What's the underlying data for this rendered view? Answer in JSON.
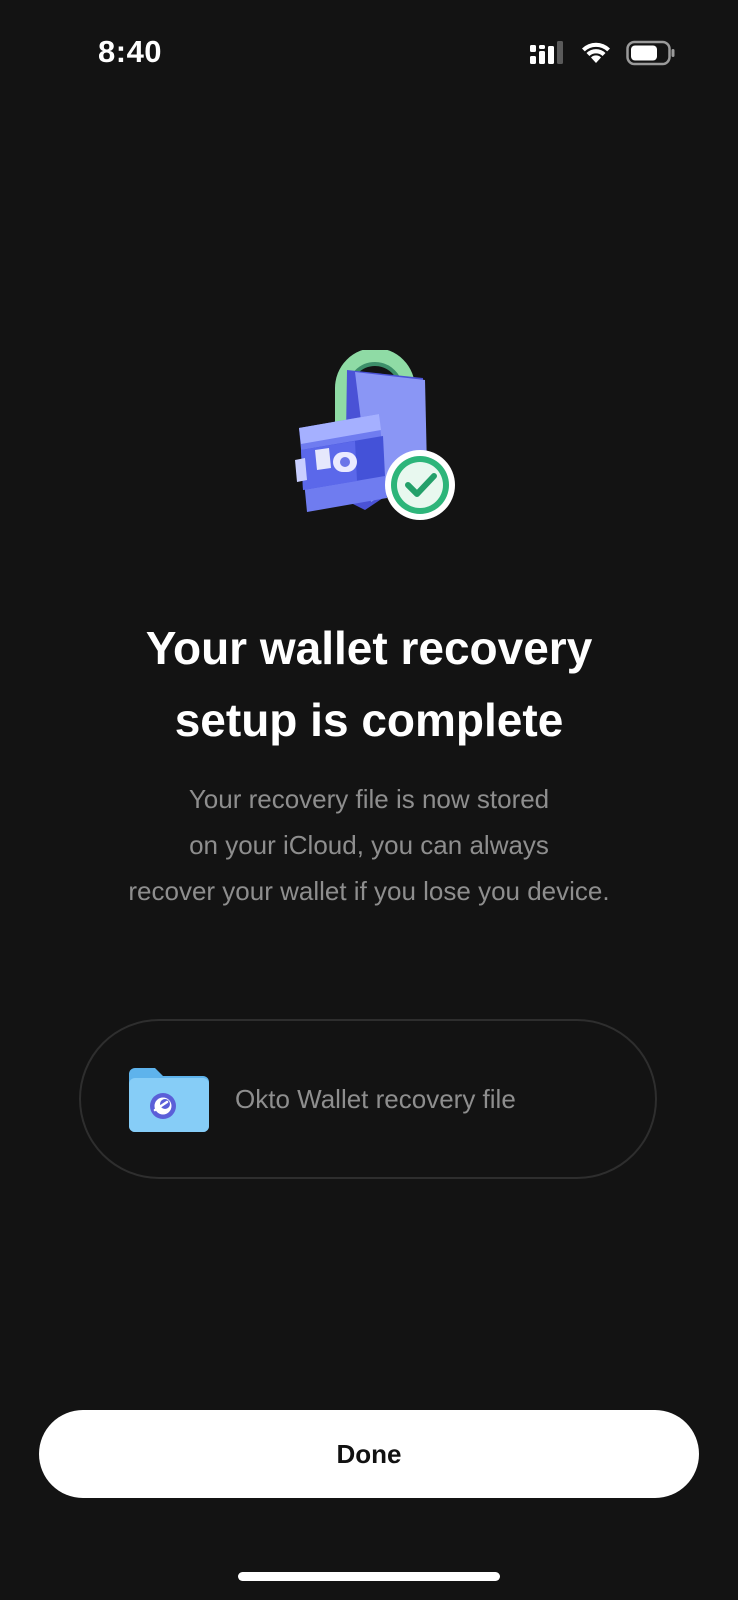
{
  "status_bar": {
    "time": "8:40",
    "icons": [
      "cellular-signal-icon",
      "wifi-icon",
      "battery-icon"
    ]
  },
  "hero": {
    "icon": "wallet-recovery-check-icon"
  },
  "title": {
    "line1": "Your wallet recovery",
    "line2": "setup is complete"
  },
  "subtitle": {
    "line1": "Your recovery file is now stored",
    "line2": "on your iCloud, you can always",
    "line3": "recover your wallet if you lose you device."
  },
  "file": {
    "icon": "folder-icon",
    "label": "Okto Wallet recovery file"
  },
  "actions": {
    "done_label": "Done"
  },
  "colors": {
    "background": "#131313",
    "text_primary": "#ffffff",
    "text_secondary": "#8e8e8e",
    "accent_blue": "#5b6cf2",
    "accent_green": "#2db57a",
    "folder_blue": "#7ec8f5"
  }
}
